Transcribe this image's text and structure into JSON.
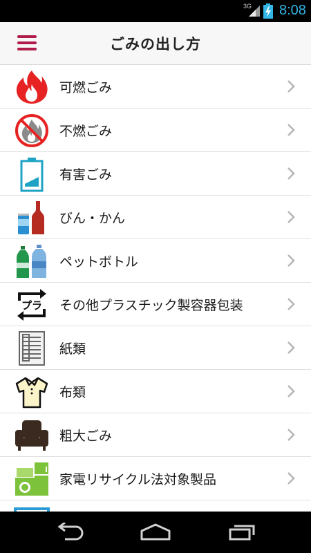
{
  "status": {
    "network": "3G",
    "time": "8:08"
  },
  "header": {
    "title": "ごみの出し方"
  },
  "items": [
    {
      "label": "可燃ごみ",
      "icon": "fire-icon"
    },
    {
      "label": "不燃ごみ",
      "icon": "no-fire-icon"
    },
    {
      "label": "有害ごみ",
      "icon": "battery-icon"
    },
    {
      "label": "びん・かん",
      "icon": "bottle-can-icon"
    },
    {
      "label": "ペットボトル",
      "icon": "pet-bottle-icon"
    },
    {
      "label": "その他プラスチック製容器包装",
      "icon": "plastic-recycle-icon"
    },
    {
      "label": "紙類",
      "icon": "paper-icon"
    },
    {
      "label": "布類",
      "icon": "shirt-icon"
    },
    {
      "label": "粗大ごみ",
      "icon": "sofa-icon"
    },
    {
      "label": "家電リサイクル法対象製品",
      "icon": "appliance-icon"
    },
    {
      "label": "",
      "icon": "monitor-icon"
    }
  ],
  "colors": {
    "accent": "#b01d4a",
    "status_time": "#33b5e5"
  }
}
